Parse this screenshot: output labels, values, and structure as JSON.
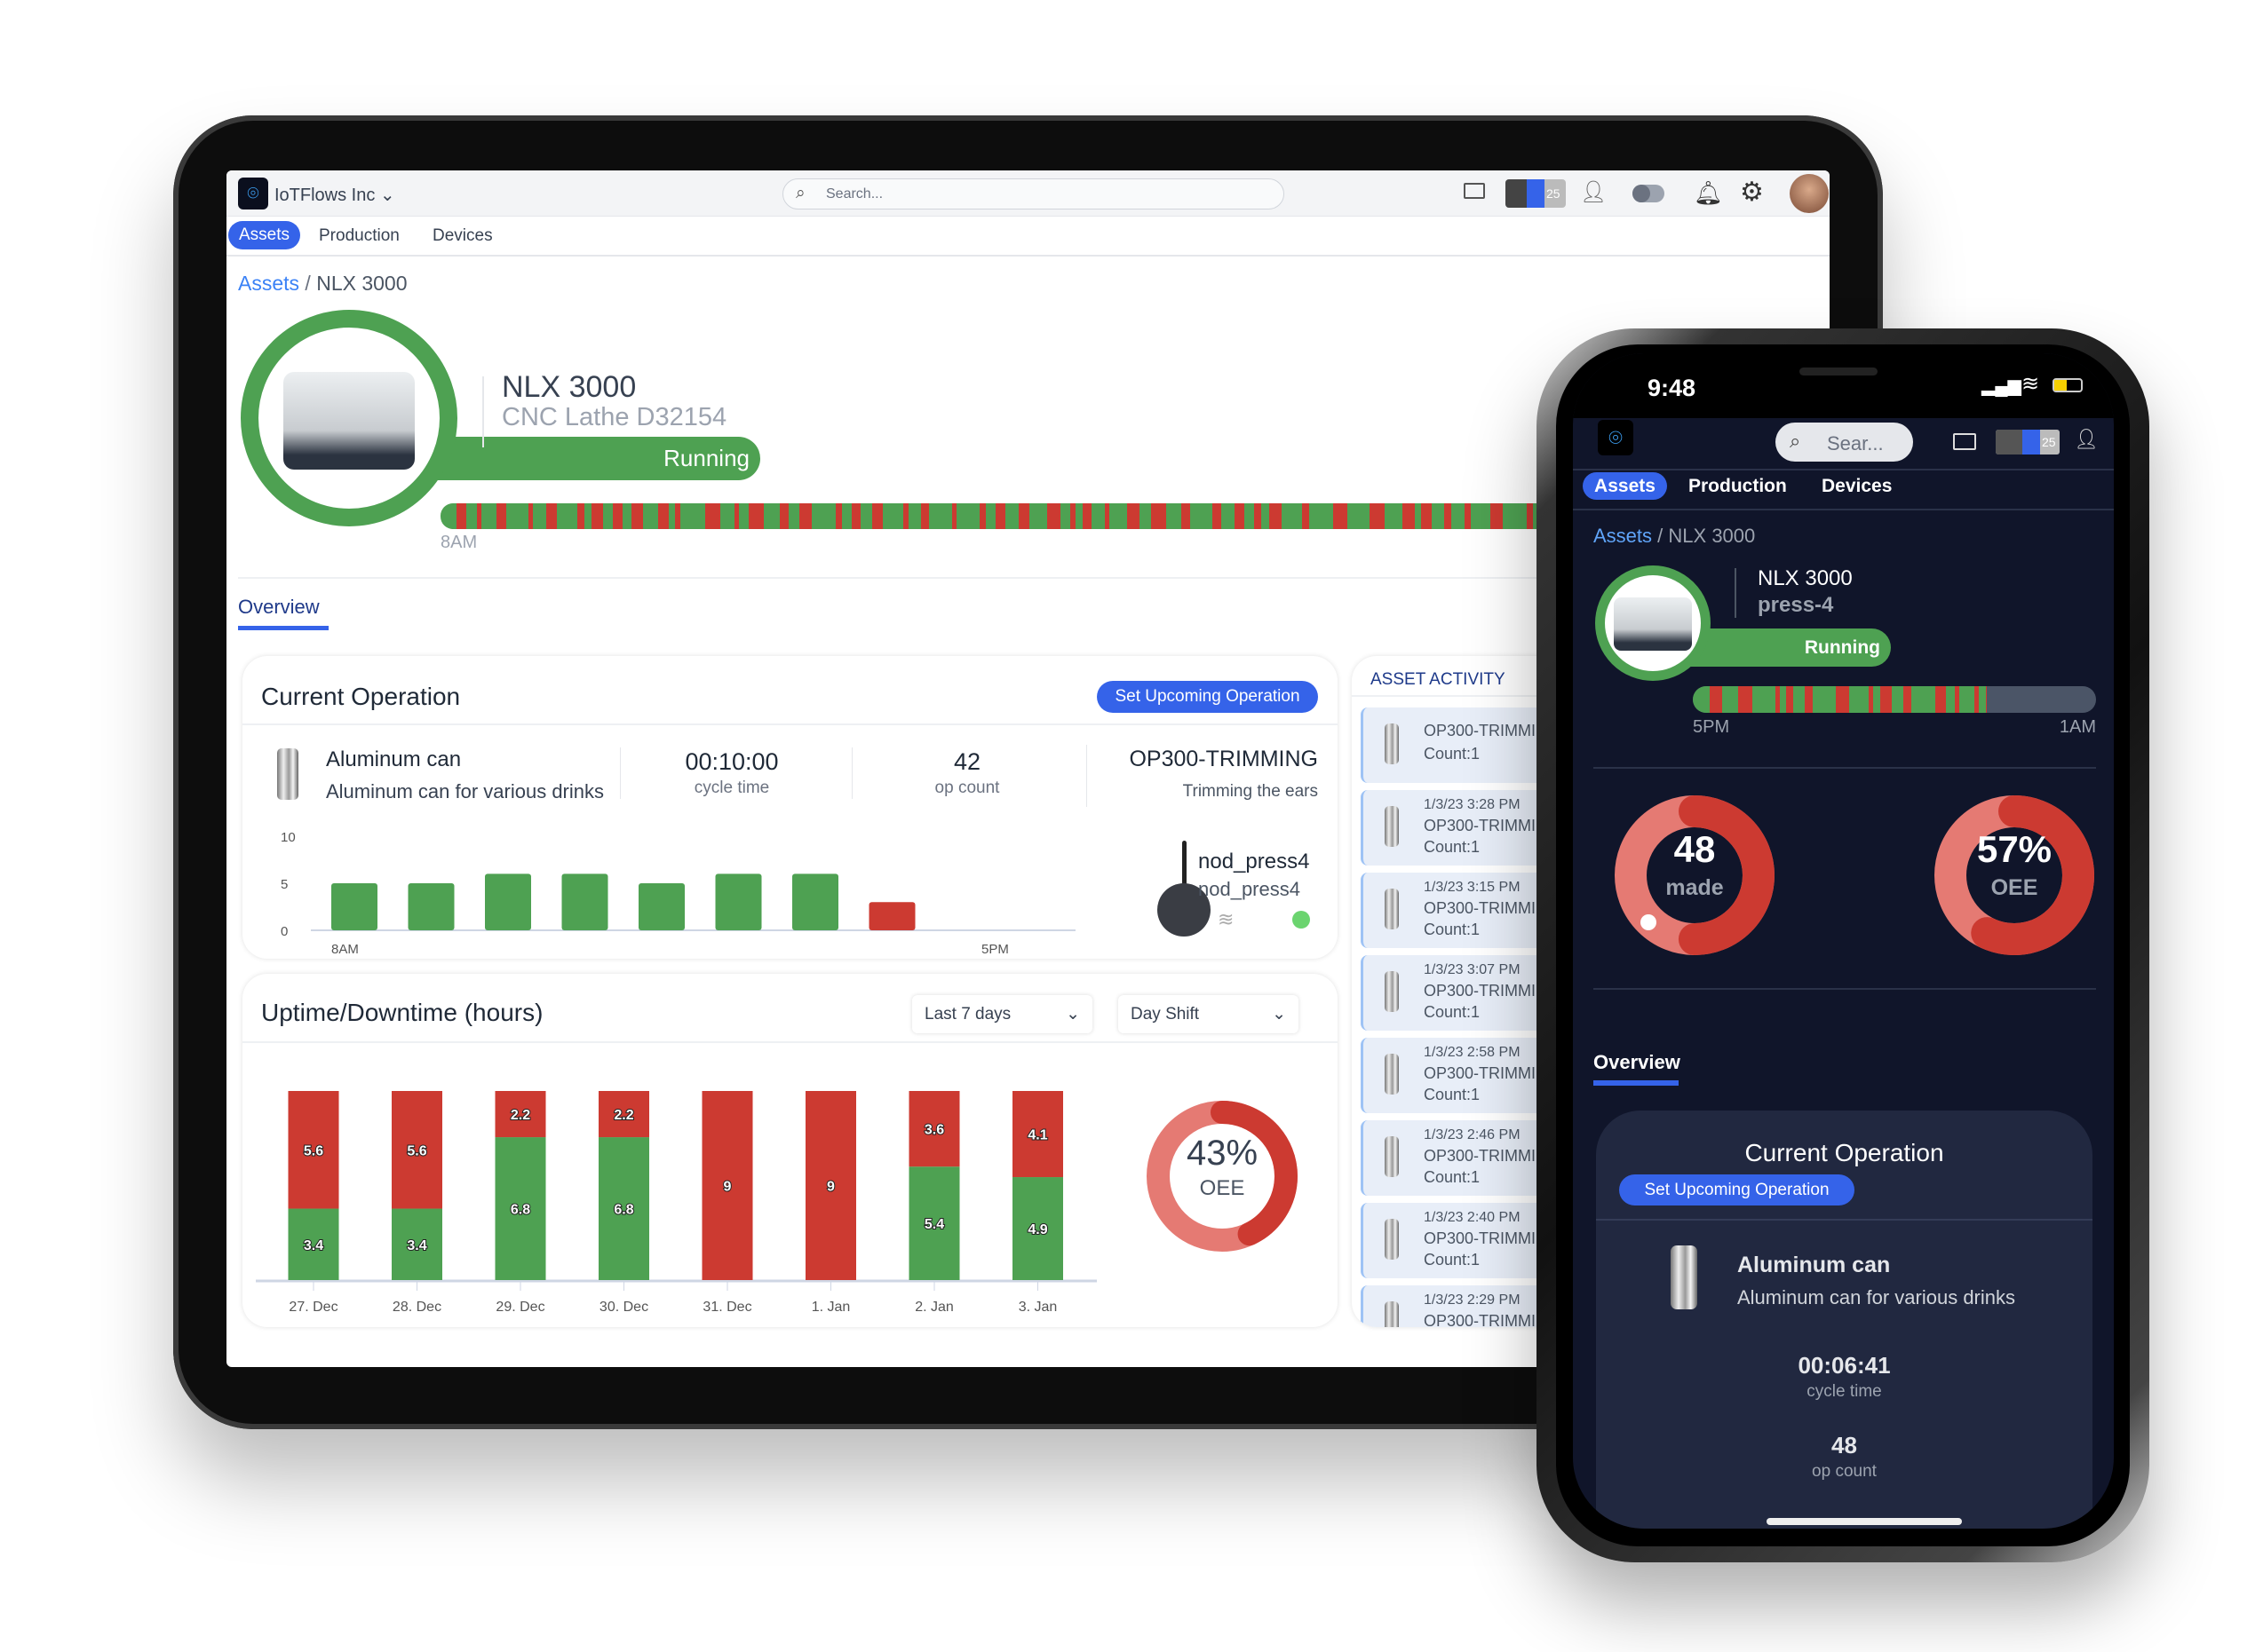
{
  "tablet": {
    "org_name": "IoTFlows Inc",
    "search_placeholder": "Search...",
    "avatar_count": "25",
    "nav_tabs": [
      {
        "label": "Assets",
        "active": true
      },
      {
        "label": "Production"
      },
      {
        "label": "Devices"
      }
    ],
    "breadcrumb": {
      "root": "Assets",
      "separator": "/",
      "current": "NLX 3000"
    },
    "asset": {
      "name": "NLX 3000",
      "subtitle": "CNC Lathe D32154",
      "status": "Running",
      "timeline_start": "8AM"
    },
    "page_tab": "Overview",
    "current_operation": {
      "title": "Current Operation",
      "button": "Set Upcoming Operation",
      "part_name": "Aluminum can",
      "part_desc": "Aluminum can for various drinks",
      "cycle_time": "00:10:00",
      "cycle_time_label": "cycle time",
      "op_count": "42",
      "op_count_label": "op count",
      "operation": "OP300-TRIMMING",
      "operation_desc": "Trimming the ears",
      "device_name": "nod_press4",
      "device_id": "nod_press4"
    },
    "asset_activity": {
      "title": "ASSET ACTIVITY",
      "items": [
        {
          "time": "",
          "op": "OP300-TRIMMING",
          "count": "Count:1"
        },
        {
          "time": "1/3/23 3:28 PM",
          "op": "OP300-TRIMMING",
          "count": "Count:1"
        },
        {
          "time": "1/3/23 3:15 PM",
          "op": "OP300-TRIMMING",
          "count": "Count:1"
        },
        {
          "time": "1/3/23 3:07 PM",
          "op": "OP300-TRIMMING",
          "count": "Count:1"
        },
        {
          "time": "1/3/23 2:58 PM",
          "op": "OP300-TRIMMING",
          "count": "Count:1"
        },
        {
          "time": "1/3/23 2:46 PM",
          "op": "OP300-TRIMMING",
          "count": "Count:1"
        },
        {
          "time": "1/3/23 2:40 PM",
          "op": "OP300-TRIMMING",
          "count": "Count:1"
        },
        {
          "time": "1/3/23 2:29 PM",
          "op": "OP300-TRIMMING",
          "count": ""
        }
      ]
    },
    "uptime": {
      "title": "Uptime/Downtime (hours)",
      "range_select": "Last 7 days",
      "shift_select": "Day Shift",
      "oee_value": "43%",
      "oee_label": "OEE"
    }
  },
  "phone": {
    "status_time": "9:48",
    "search_placeholder": "Sear...",
    "avatar_count": "25",
    "nav_tabs": [
      {
        "label": "Assets",
        "active": true
      },
      {
        "label": "Production"
      },
      {
        "label": "Devices"
      }
    ],
    "breadcrumb": {
      "root": "Assets",
      "separator": "/",
      "current": "NLX 3000"
    },
    "asset": {
      "name": "NLX 3000",
      "subtitle": "press-4",
      "status": "Running",
      "timeline_start": "5PM",
      "timeline_end": "1AM"
    },
    "made_value": "48",
    "made_label": "made",
    "oee_value": "57%",
    "oee_label": "OEE",
    "page_tab": "Overview",
    "current_operation": {
      "title": "Current Operation",
      "button": "Set Upcoming Operation",
      "part_name": "Aluminum can",
      "part_desc": "Aluminum can for various drinks",
      "cycle_time": "00:06:41",
      "cycle_time_label": "cycle time",
      "op_count": "48",
      "op_count_label": "op count"
    }
  },
  "colors": {
    "accent": "#3563e9",
    "running": "#4ea152",
    "down": "#cc3a31",
    "down_light": "#e57a73",
    "phone_bg": "#10152a"
  },
  "chart_data": [
    {
      "type": "bar",
      "title": "",
      "categories_label_start": "8AM",
      "categories_label_end": "5PM",
      "values": [
        5,
        5,
        6,
        6,
        5,
        6,
        6,
        3
      ],
      "bar_colors": [
        "#4ea152",
        "#4ea152",
        "#4ea152",
        "#4ea152",
        "#4ea152",
        "#4ea152",
        "#4ea152",
        "#cc3a31"
      ],
      "yticks": [
        0,
        5,
        10
      ],
      "ylim": [
        0,
        10
      ],
      "grid": false
    },
    {
      "type": "bar",
      "stacked": true,
      "title": "Uptime/Downtime (hours)",
      "categories": [
        "27. Dec",
        "28. Dec",
        "29. Dec",
        "30. Dec",
        "31. Dec",
        "1. Jan",
        "2. Jan",
        "3. Jan"
      ],
      "series": [
        {
          "values": [
            3.4,
            3.4,
            6.8,
            6.8,
            0,
            0,
            5.4,
            4.9
          ],
          "color": "#4ea152"
        },
        {
          "values": [
            5.6,
            5.6,
            2.2,
            2.2,
            9,
            9,
            3.6,
            4.1
          ],
          "color": "#cc3a31"
        }
      ],
      "ylim": [
        0,
        9
      ],
      "grid": false
    },
    {
      "type": "pie",
      "donut": true,
      "value_percent": 43,
      "label": "OEE"
    },
    {
      "type": "pie",
      "donut": true,
      "value_percent": 57,
      "label": "OEE"
    }
  ]
}
